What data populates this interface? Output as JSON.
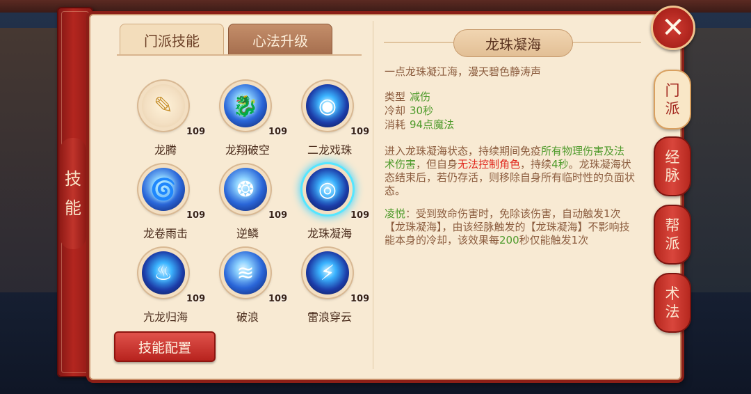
{
  "left_rail": {
    "label_chars": [
      "技",
      "能"
    ]
  },
  "tabs": {
    "active": "门派技能",
    "inactive": "心法升级"
  },
  "skills": [
    {
      "name": "龙腾",
      "level": "109",
      "style": "gold",
      "glyph": "✎"
    },
    {
      "name": "龙翔破空",
      "level": "109",
      "style": "blue",
      "glyph": "🐉"
    },
    {
      "name": "二龙戏珠",
      "level": "109",
      "style": "deep",
      "glyph": "◉"
    },
    {
      "name": "龙卷雨击",
      "level": "109",
      "style": "blue",
      "glyph": "🌀"
    },
    {
      "name": "逆鳞",
      "level": "109",
      "style": "blue",
      "glyph": "❂"
    },
    {
      "name": "龙珠凝海",
      "level": "109",
      "style": "deep",
      "glyph": "◎",
      "selected": true
    },
    {
      "name": "亢龙归海",
      "level": "109",
      "style": "deep",
      "glyph": "♨"
    },
    {
      "name": "破浪",
      "level": "109",
      "style": "blue",
      "glyph": "≋"
    },
    {
      "name": "雷浪穿云",
      "level": "109",
      "style": "deep",
      "glyph": "⚡"
    }
  ],
  "config_button": "技能配置",
  "detail": {
    "title": "龙珠凝海",
    "desc": "一点龙珠凝江海，漫天碧色静涛声",
    "stats": [
      {
        "key": "类型",
        "value": "减伤"
      },
      {
        "key": "冷却",
        "value": "30秒"
      },
      {
        "key": "消耗",
        "value": "94点魔法"
      }
    ],
    "effect_parts": [
      {
        "t": "进入龙珠凝海状态，持续期间免疫",
        "c": "normal"
      },
      {
        "t": "所有物理伤害及法术伤害",
        "c": "green"
      },
      {
        "t": "，但自身",
        "c": "normal"
      },
      {
        "t": "无法控制角色",
        "c": "red"
      },
      {
        "t": "，持续",
        "c": "normal"
      },
      {
        "t": "4秒",
        "c": "green"
      },
      {
        "t": "。龙珠凝海状态结束后，若仍存活，则移除自身所有临时性的负面状态。",
        "c": "normal"
      }
    ],
    "bonus_parts": [
      {
        "t": "凌悦",
        "c": "green"
      },
      {
        "t": "：受到致命伤害时，免除该伤害，自动触发1次【龙珠凝海】，由该经脉触发的【龙珠凝海】不影响技能本身的冷却，该效果每",
        "c": "normal"
      },
      {
        "t": "200",
        "c": "green"
      },
      {
        "t": "秒仅能触发1次",
        "c": "normal"
      }
    ]
  },
  "right_tabs": [
    {
      "chars": [
        "门",
        "派"
      ],
      "active": true
    },
    {
      "chars": [
        "经",
        "脉"
      ],
      "active": false
    },
    {
      "chars": [
        "帮",
        "派"
      ],
      "active": false
    },
    {
      "chars": [
        "术",
        "法"
      ],
      "active": false
    }
  ],
  "close_glyph": "✕"
}
